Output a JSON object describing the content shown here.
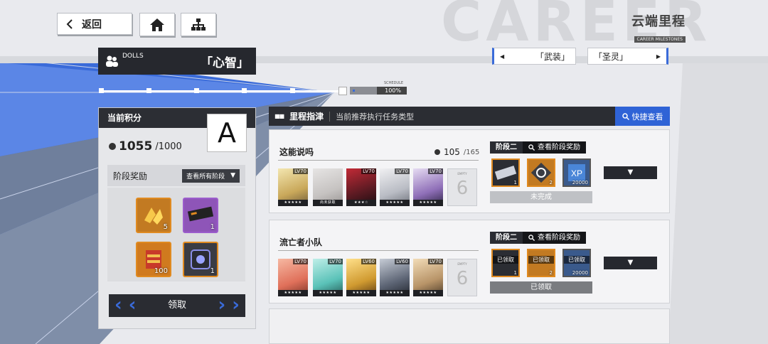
{
  "nav": {
    "back_label": "返回"
  },
  "logo": {
    "cn": "云端里程",
    "en": "CAREER MILESTONES"
  },
  "watermark": "CAREER",
  "filters": {
    "left": "「武装」",
    "right": "「圣灵」"
  },
  "dolls_header": {
    "label": "DOLLS",
    "title": "「心智」"
  },
  "schedule": {
    "label": "SCHEDULE",
    "value": "100%"
  },
  "left_panel": {
    "heading": "当前积分",
    "grade": "A",
    "points": "1055",
    "points_max": "/1000",
    "stage_label": "阶段奖励",
    "stage_dropdown": "查看所有阶段",
    "rewards": [
      {
        "qty": "5",
        "icon": "gold-shards-icon"
      },
      {
        "qty": "1",
        "icon": "module-chip-icon"
      },
      {
        "qty": "100",
        "icon": "supply-box-icon"
      },
      {
        "qty": "1",
        "icon": "core-module-icon"
      }
    ],
    "claim_label": "领取"
  },
  "milestones": {
    "title": "里程指津",
    "subtitle": "当前推荐执行任务类型",
    "quick_view": "快捷查看"
  },
  "cards": [
    {
      "title": "这能说吗",
      "score": "105",
      "score_max": "/165",
      "dolls": [
        {
          "lv": "LV70",
          "stars": "★★★★★"
        },
        {
          "lv": "",
          "stars": "尚未获取"
        },
        {
          "lv": "LV70",
          "stars": "★★★☆"
        },
        {
          "lv": "LV70",
          "stars": "★★★★★"
        },
        {
          "lv": "LV70",
          "stars": "★★★★★"
        }
      ],
      "empty_label": "EMPTY",
      "empty_num": "6",
      "stage": "阶段二",
      "stage_view": "查看阶段奖励",
      "stage_rewards": [
        {
          "qty": "1",
          "claimed": ""
        },
        {
          "qty": "2",
          "claimed": ""
        },
        {
          "qty": "20000",
          "claimed": ""
        }
      ],
      "status": "未完成"
    },
    {
      "title": "流亡者小队",
      "score": "",
      "score_max": "",
      "dolls": [
        {
          "lv": "LV70",
          "stars": "★★★★★"
        },
        {
          "lv": "LV70",
          "stars": "★★★★★"
        },
        {
          "lv": "LV60",
          "stars": "★★★★★"
        },
        {
          "lv": "LV60",
          "stars": "★★★★★"
        },
        {
          "lv": "LV70",
          "stars": "★★★★★"
        }
      ],
      "empty_label": "EMPTY",
      "empty_num": "6",
      "stage": "阶段二",
      "stage_view": "查看阶段奖励",
      "stage_rewards": [
        {
          "qty": "1",
          "claimed": "已领取"
        },
        {
          "qty": "2",
          "claimed": "已领取"
        },
        {
          "qty": "20000",
          "claimed": "已领取"
        }
      ],
      "status": "已领取"
    }
  ],
  "colors": {
    "accent": "#2f63d6",
    "dark": "#2b2d33",
    "orange": "#e08a20"
  }
}
